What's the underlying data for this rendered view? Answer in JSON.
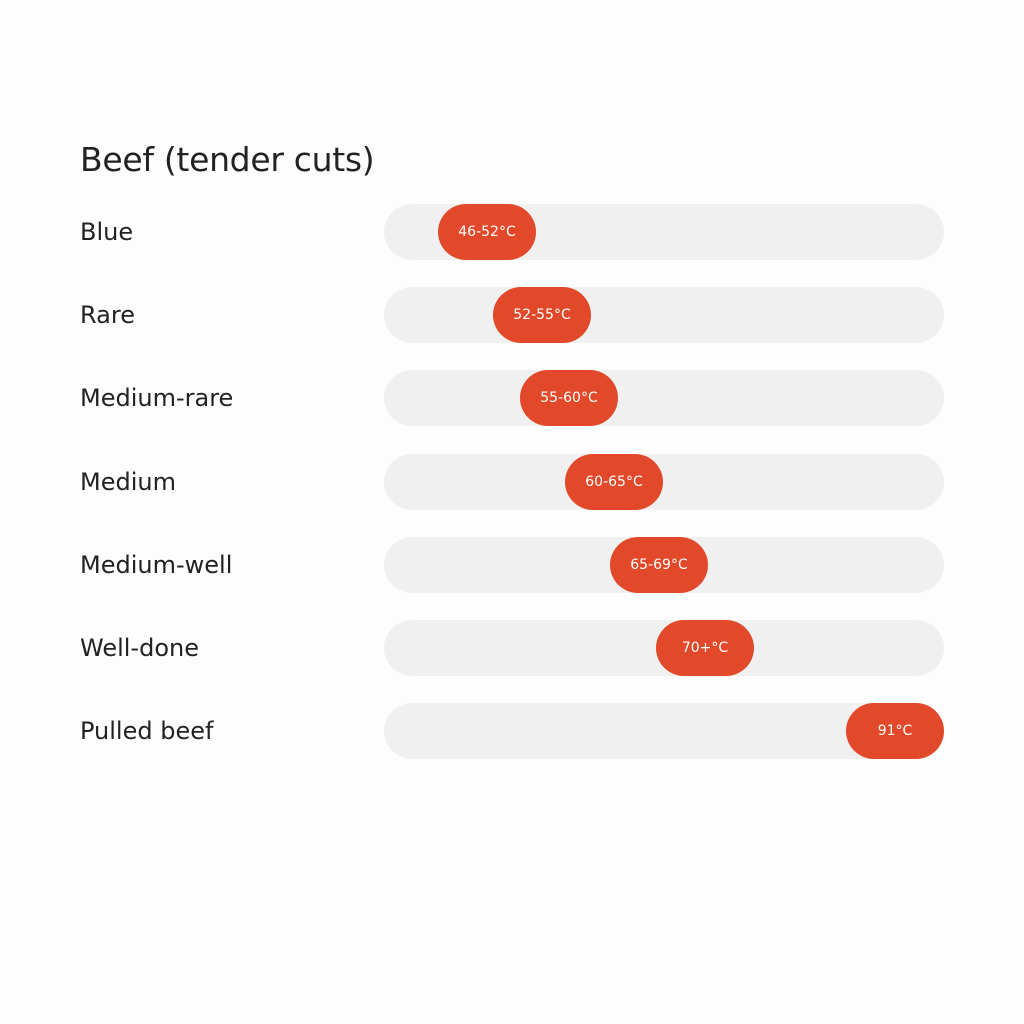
{
  "chart_data": {
    "type": "bar",
    "title": "Beef (tender cuts)",
    "unit": "°C",
    "categories": [
      "Blue",
      "Rare",
      "Medium-rare",
      "Medium",
      "Medium-well",
      "Well-done",
      "Pulled beef"
    ],
    "series": [
      {
        "values": [
          {
            "label": "46-52°C",
            "min": 46,
            "max": 52
          },
          {
            "label": "52-55°C",
            "min": 52,
            "max": 55
          },
          {
            "label": "55-60°C",
            "min": 55,
            "max": 60
          },
          {
            "label": "60-65°C",
            "min": 60,
            "max": 65
          },
          {
            "label": "65-69°C",
            "min": 65,
            "max": 69
          },
          {
            "label": "70+°C",
            "min": 70,
            "max": 70
          },
          {
            "label": "91°C",
            "min": 91,
            "max": 91
          }
        ]
      }
    ],
    "xlim": [
      40,
      91
    ],
    "colors": {
      "marker": "#e2492a",
      "track": "#f0f0f0",
      "text": "#222222"
    }
  }
}
